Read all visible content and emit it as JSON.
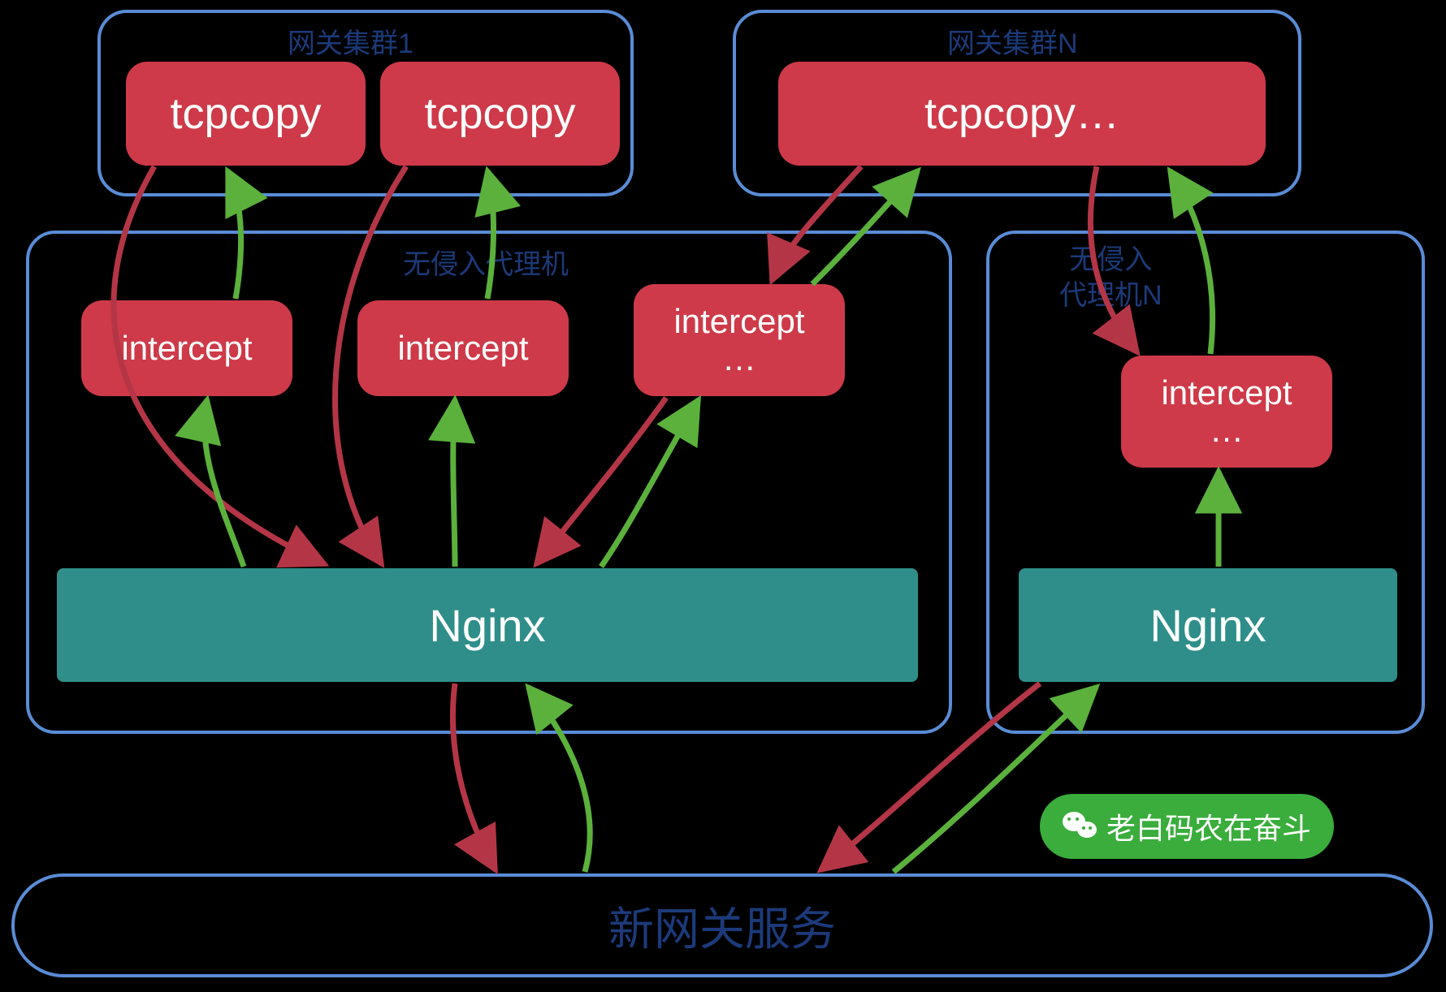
{
  "clusters": {
    "gateway1": {
      "label": "网关集群1"
    },
    "gatewayN": {
      "label": "网关集群N"
    },
    "proxy1": {
      "label": "无侵入代理机"
    },
    "proxyN": {
      "label": "无侵入\n代理机N"
    }
  },
  "nodes": {
    "tcpcopy1": "tcpcopy",
    "tcpcopy2": "tcpcopy",
    "tcpcopyN": "tcpcopy…",
    "intercept1": "intercept",
    "intercept2": "intercept",
    "intercept3": "intercept\n…",
    "interceptN": "intercept\n…",
    "nginx1": "Nginx",
    "nginxN": "Nginx"
  },
  "bottom": {
    "label": "新网关服务"
  },
  "badge": {
    "label": "老白码农在奋斗"
  },
  "colors": {
    "red_arrow": "#b43646",
    "green_arrow": "#5bb13c",
    "node_red": "#ce3a49",
    "node_teal": "#2f8e89",
    "border_blue": "#5a8cd6",
    "label_blue": "#1c3a7a",
    "badge_green": "#3aad3c"
  },
  "arrows": [
    {
      "from": "tcpcopy1",
      "to": "nginx1",
      "color": "red"
    },
    {
      "from": "intercept1",
      "to": "tcpcopy1",
      "color": "green"
    },
    {
      "from": "tcpcopy2",
      "to": "nginx1",
      "color": "red"
    },
    {
      "from": "intercept2",
      "to": "tcpcopy2",
      "color": "green"
    },
    {
      "from": "nginx1",
      "to": "intercept1",
      "color": "green"
    },
    {
      "from": "nginx1",
      "to": "intercept2",
      "color": "green"
    },
    {
      "from": "nginx1",
      "to": "intercept3",
      "color": "green"
    },
    {
      "from": "intercept3",
      "to": "nginx1",
      "color": "red"
    },
    {
      "from": "tcpcopyN",
      "to": "intercept3",
      "color": "red"
    },
    {
      "from": "intercept3",
      "to": "tcpcopyN",
      "color": "green"
    },
    {
      "from": "tcpcopyN",
      "to": "interceptN",
      "color": "red"
    },
    {
      "from": "interceptN",
      "to": "tcpcopyN",
      "color": "green"
    },
    {
      "from": "nginxN",
      "to": "interceptN",
      "color": "green"
    },
    {
      "from": "nginx1",
      "to": "bottom",
      "color": "red"
    },
    {
      "from": "bottom",
      "to": "nginx1",
      "color": "green"
    },
    {
      "from": "nginxN",
      "to": "bottom",
      "color": "red"
    },
    {
      "from": "bottom",
      "to": "nginxN",
      "color": "green"
    }
  ]
}
